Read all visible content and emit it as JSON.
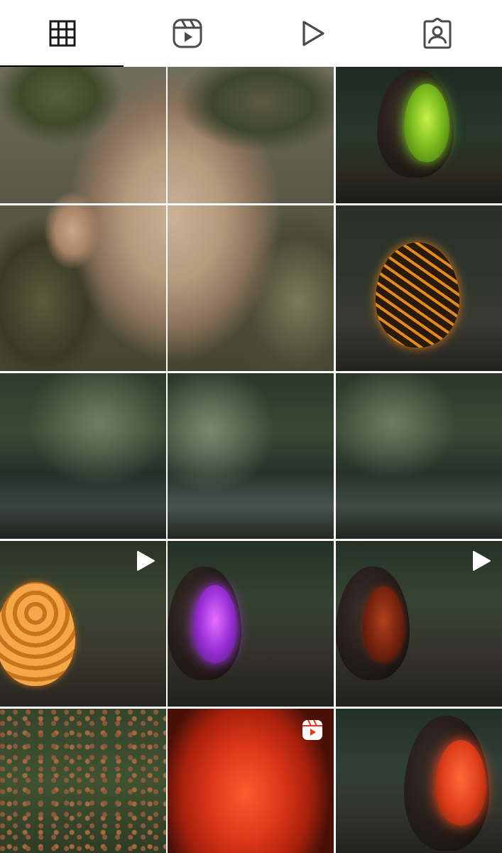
{
  "tabs": [
    {
      "name": "posts-grid",
      "icon": "grid-icon",
      "active": true
    },
    {
      "name": "reels",
      "icon": "reels-icon",
      "active": false
    },
    {
      "name": "videos",
      "icon": "play-icon",
      "active": false
    },
    {
      "name": "tagged",
      "icon": "tagged-person-icon",
      "active": false
    }
  ],
  "colors": {
    "tab_icon": "#1c1c1c",
    "tab_icon_muted": "#4a4a4a",
    "indicator": "#000000",
    "grid_gap": "#ffffff"
  },
  "grid": {
    "rows": 5,
    "columns": 3,
    "tiles": [
      {
        "row": 1,
        "col": 1,
        "subject": "creature-face-portrait-part",
        "badge": null
      },
      {
        "row": 1,
        "col": 2,
        "subject": "creature-face-portrait-part",
        "badge": null
      },
      {
        "row": 1,
        "col": 3,
        "subject": "dark-egg-green-glow",
        "badge": null
      },
      {
        "row": 2,
        "col": 1,
        "subject": "creature-face-portrait-part",
        "badge": null
      },
      {
        "row": 2,
        "col": 2,
        "subject": "creature-face-portrait-part",
        "badge": null
      },
      {
        "row": 2,
        "col": 3,
        "subject": "orange-glowing-egg",
        "badge": null
      },
      {
        "row": 3,
        "col": 1,
        "subject": "forest-stream",
        "badge": null
      },
      {
        "row": 3,
        "col": 2,
        "subject": "forest-stream",
        "badge": null
      },
      {
        "row": 3,
        "col": 3,
        "subject": "forest-stream",
        "badge": null
      },
      {
        "row": 4,
        "col": 1,
        "subject": "scaled-orange-egg",
        "badge": "play-icon"
      },
      {
        "row": 4,
        "col": 2,
        "subject": "dark-egg-purple-glow",
        "badge": null
      },
      {
        "row": 4,
        "col": 3,
        "subject": "dark-egg-red-glow",
        "badge": "play-icon"
      },
      {
        "row": 5,
        "col": 1,
        "subject": "leaf-covered-ground",
        "badge": null
      },
      {
        "row": 5,
        "col": 2,
        "subject": "red-glowing-egg-closeup",
        "badge": "reels-icon"
      },
      {
        "row": 5,
        "col": 3,
        "subject": "dark-egg-red-glow",
        "badge": null
      }
    ]
  }
}
